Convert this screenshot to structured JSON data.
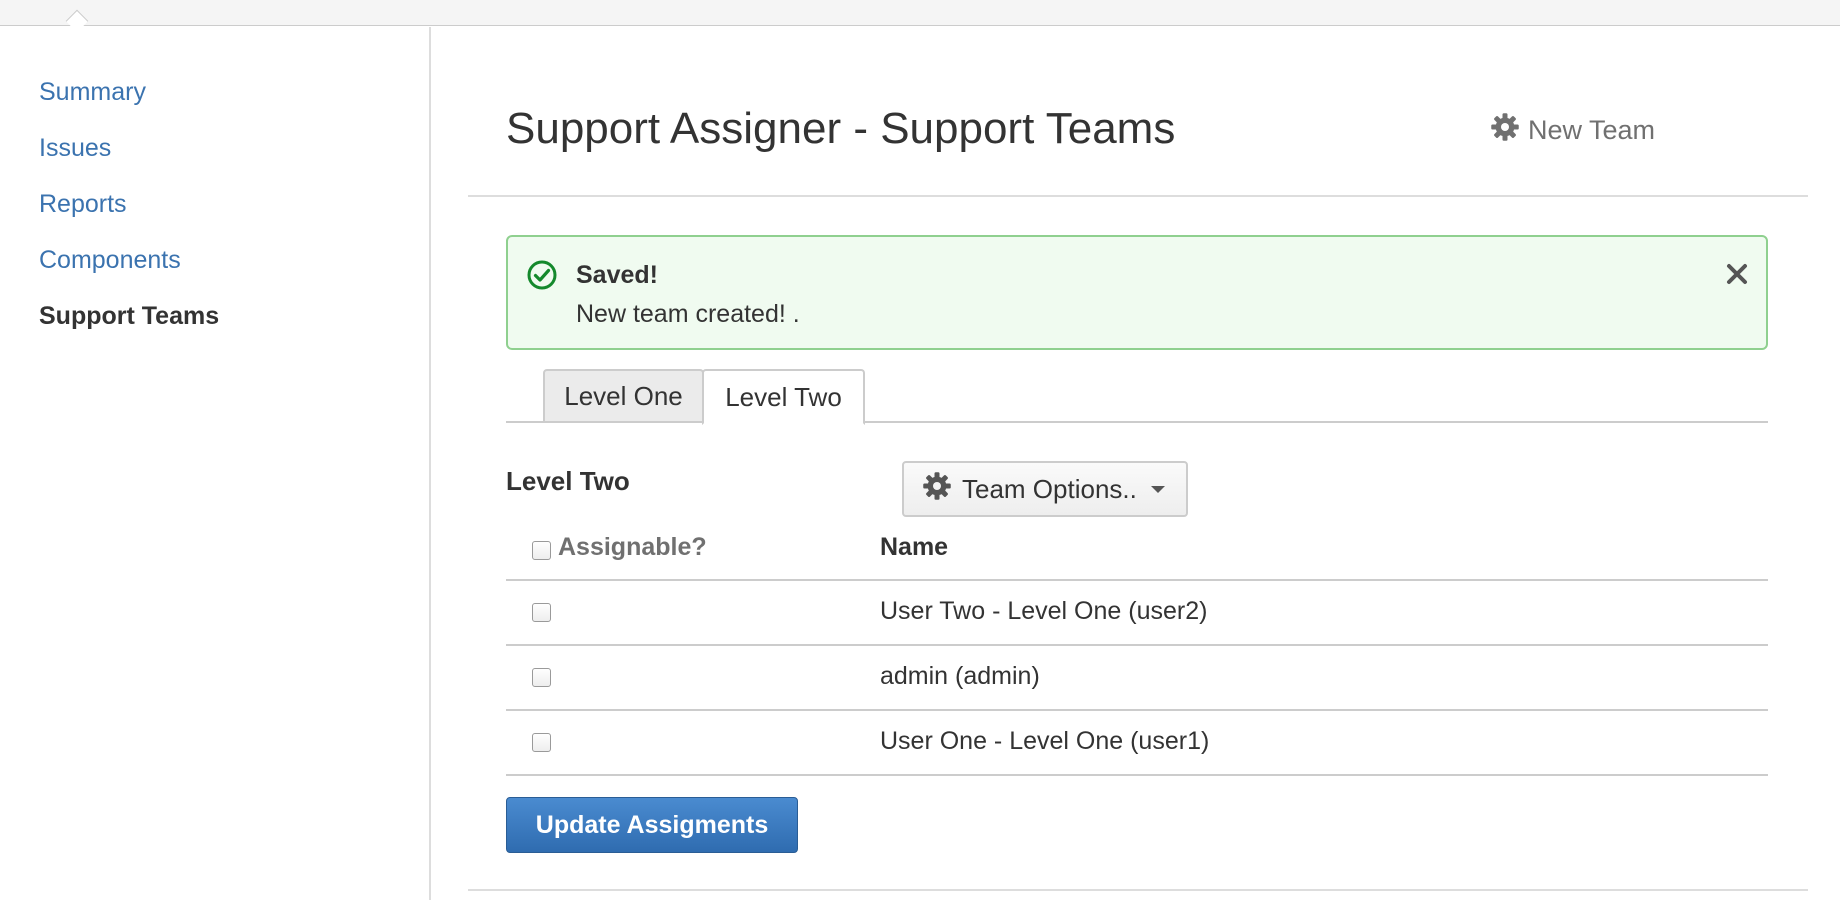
{
  "sidebar": {
    "items": [
      {
        "label": "Summary",
        "active": false
      },
      {
        "label": "Issues",
        "active": false
      },
      {
        "label": "Reports",
        "active": false
      },
      {
        "label": "Components",
        "active": false
      },
      {
        "label": "Support Teams",
        "active": true
      }
    ]
  },
  "header": {
    "title": "Support Assigner - Support Teams",
    "new_team_label": "New Team",
    "new_team_icon": "gear-icon"
  },
  "message": {
    "title": "Saved!",
    "body": "New team created! .",
    "type": "success",
    "icon": "check-circle-icon",
    "close_icon": "close-icon"
  },
  "tabs": [
    {
      "label": "Level One",
      "active": false
    },
    {
      "label": "Level Two",
      "active": true
    }
  ],
  "team": {
    "label": "Level Two",
    "options_label": "Team Options..",
    "options_icon": "gear-icon"
  },
  "table": {
    "headers": {
      "assignable": "Assignable?",
      "name": "Name"
    },
    "rows": [
      {
        "name": "User Two - Level One (user2)",
        "assignable": false
      },
      {
        "name": "admin (admin)",
        "assignable": false
      },
      {
        "name": "User One - Level One (user1)",
        "assignable": false
      }
    ]
  },
  "actions": {
    "update_label": "Update Assigments"
  },
  "colors": {
    "link": "#3b73af",
    "success_border": "#8fd08f",
    "success_bg": "#f0fbf0",
    "success_icon": "#14892c",
    "primary_button": "#3572b0"
  }
}
